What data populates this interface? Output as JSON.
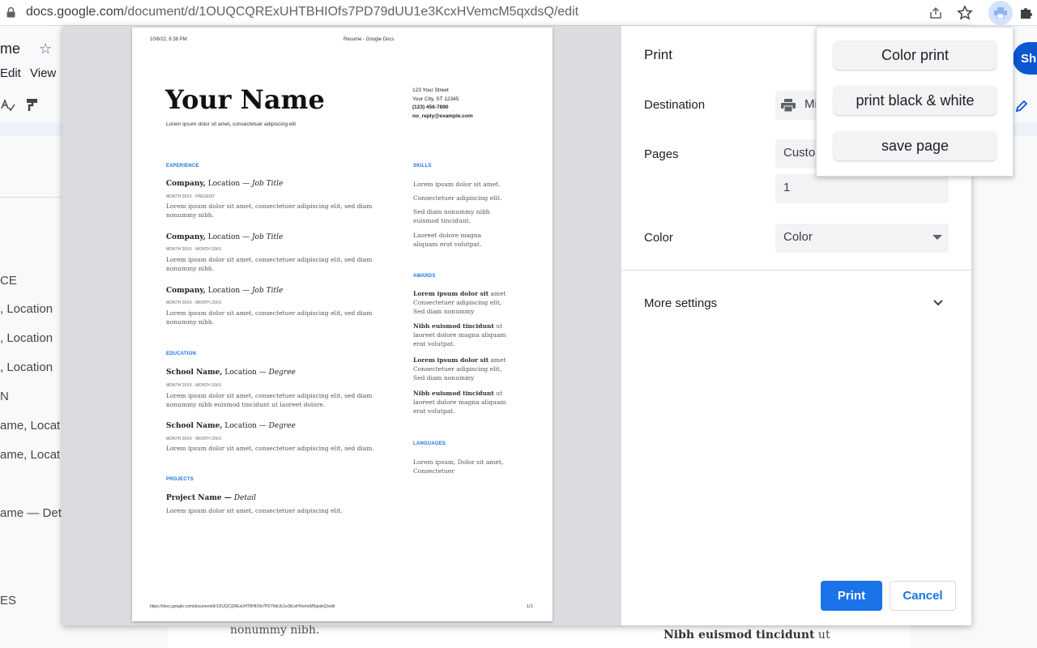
{
  "browser": {
    "url_host": "docs.google.com",
    "url_path": "/document/d/1OUQCQRExUHTBHIOfs7PD79dUU1e3KcxHVemcM5qxdsQ/edit"
  },
  "docs": {
    "title_fragment": "me",
    "star": "☆",
    "menu": {
      "edit": "Edit",
      "view": "View"
    },
    "share_fragment": "Sh",
    "outline": [
      "CE",
      ", Location",
      ", Location",
      ", Location",
      "N",
      "ame, Locat",
      "ame, Locat",
      "ame — Det",
      "ES"
    ],
    "doc_text_1": "nonummy nibh.",
    "doc_text_2_bold": "Nibh euismod tincidunt",
    "doc_text_2_rest": " ut"
  },
  "preview": {
    "header_left": "10/6/22, 6:38 PM",
    "header_center": "Resume - Google Docs",
    "name": "Your Name",
    "tagline": "Lorem ipsum dolor sit amet, consectetuer adipiscing elit",
    "contact": [
      "123 Your Street",
      "Your City, ST 12345",
      "(123) 456-7890",
      "no_reply@example.com"
    ],
    "experience_heading": "EXPERIENCE",
    "experience": [
      {
        "company": "Company,",
        "location": " Location — ",
        "title": "Job Title",
        "dates": "MONTH 20XX - PRESENT",
        "desc": "Lorem ipsum dolor sit amet, consectetuer adipiscing elit, sed diam nonummy nibh."
      },
      {
        "company": "Company,",
        "location": " Location — ",
        "title": "Job Title",
        "dates": "MONTH 20XX - MONTH 20XX",
        "desc": "Lorem ipsum dolor sit amet, consectetuer adipiscing elit, sed diam nonummy nibh."
      },
      {
        "company": "Company,",
        "location": " Location — ",
        "title": "Job Title",
        "dates": "MONTH 20XX - MONTH 20XX",
        "desc": "Lorem ipsum dolor sit amet, consectetuer adipiscing elit, sed diam nonummy nibh."
      }
    ],
    "education_heading": "EDUCATION",
    "education": [
      {
        "school": "School Name,",
        "location": " Location — ",
        "degree": "Degree",
        "dates": "MONTH 20XX - MONTH 20XX",
        "desc": "Lorem ipsum dolor sit amet, consectetuer adipiscing elit, sed diam nonummy nibh euismod tincidunt ut laoreet dolore."
      },
      {
        "school": "School Name,",
        "location": " Location — ",
        "degree": "Degree",
        "dates": "MONTH 20XX - MONTH 20XX",
        "desc": "Lorem ipsum dolor sit amet, consectetuer adipiscing elit, sed diam."
      }
    ],
    "projects_heading": "PROJECTS",
    "project": {
      "name": "Project Name — ",
      "detail": "Detail",
      "desc": "Lorem ipsum dolor sit amet, consectetuer adipiscing elit."
    },
    "skills_heading": "SKILLS",
    "skills": [
      "Lorem ipsum dolor sit amet.",
      "Consectetuer adipiscing elit.",
      "Sed diam nonummy nibh euismod tincidunt.",
      "Laoreet dolore magna aliquam erat volutpat."
    ],
    "awards_heading": "AWARDS",
    "awards": [
      {
        "bold": "Lorem ipsum dolor sit",
        "rest": " amet Consectetuer adipiscing elit, Sed diam nonummy"
      },
      {
        "bold": "Nibh euismod tincidunt",
        "rest": " ut laoreet dolore magna aliquam erat volutpat."
      },
      {
        "bold": "Lorem ipsum dolor sit",
        "rest": " amet Consectetuer adipiscing elit, Sed diam nonummy"
      },
      {
        "bold": "Nibh euismod tincidunt",
        "rest": " ut laoreet dolore magna aliquam erat volutpat."
      }
    ],
    "languages_heading": "LANGUAGES",
    "languages": "Lorem ipsum, Dolor sit amet, Consectetuer",
    "footer_url": "https://docs.google.com/document/d/1OUQCQRExUHTBHIOfs7PD79dUU1e3KcxHVemcM5qxdsQ/edit",
    "footer_page": "1/1"
  },
  "print": {
    "title": "Print",
    "destination_label": "Destination",
    "destination_value": "Mi",
    "pages_label": "Pages",
    "pages_value": "Custo",
    "pages_input": "1",
    "color_label": "Color",
    "color_value": "Color",
    "more_settings": "More settings",
    "print_button": "Print",
    "cancel_button": "Cancel"
  },
  "extension_popup": {
    "color_print": "Color print",
    "bw_print": "print black & white",
    "save_page": "save page"
  }
}
